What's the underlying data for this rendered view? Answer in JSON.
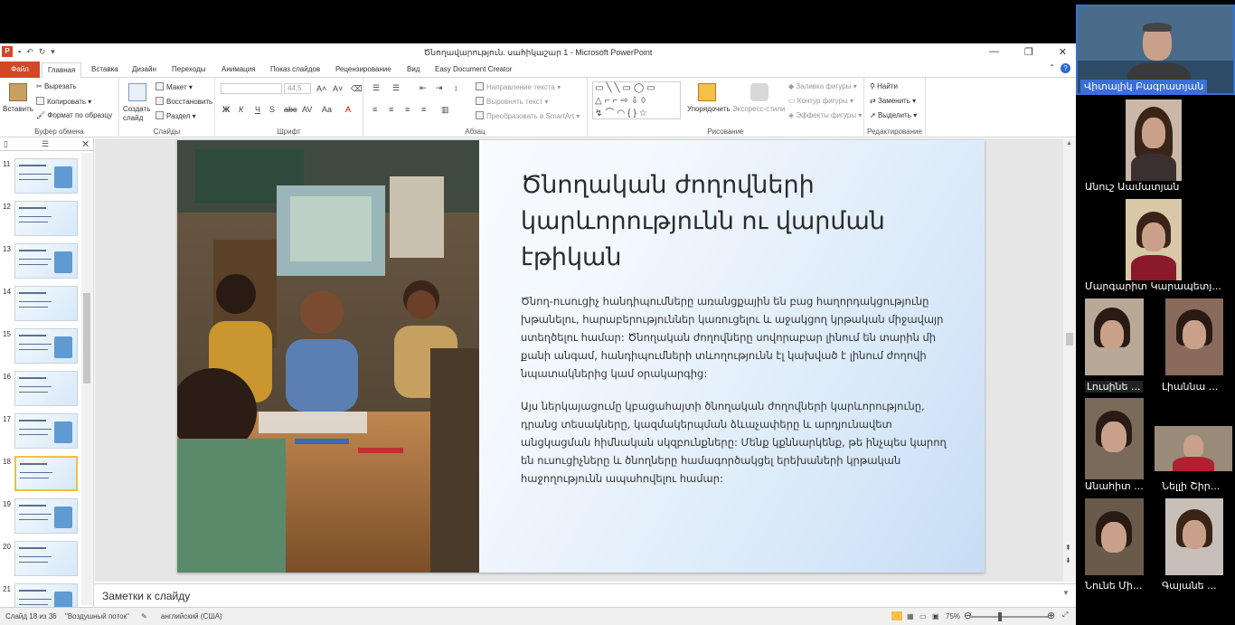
{
  "window": {
    "title": "Ծնողավարություն. սահիկաշար 1  -  Microsoft PowerPoint",
    "app_icon": "P"
  },
  "tabs": {
    "file": "Файл",
    "items": [
      "Главная",
      "Вставка",
      "Дизайн",
      "Переходы",
      "Анимация",
      "Показ слайдов",
      "Рецензирование",
      "Вид",
      "Easy Document Creator"
    ],
    "active": "Главная"
  },
  "ribbon": {
    "clipboard": {
      "paste": "Вставить",
      "cut": "Вырезать",
      "copy": "Копировать",
      "format_painter": "Формат по образцу",
      "label": "Буфер обмена"
    },
    "slides": {
      "new_slide": "Создать слайд",
      "layout": "Макет",
      "reset": "Восстановить",
      "section": "Раздел",
      "label": "Слайды"
    },
    "font": {
      "size": "44,5",
      "label": "Шрифт"
    },
    "paragraph": {
      "text_direction": "Направление текста",
      "align_text": "Выровнять текст",
      "smartart": "Преобразовать в SmartArt",
      "label": "Абзац"
    },
    "drawing": {
      "arrange": "Упорядочить",
      "quick_styles": "Экспресс-стили",
      "shape_fill": "Заливка фигуры",
      "shape_outline": "Контур фигуры",
      "shape_effects": "Эффекты фигуры",
      "label": "Рисование"
    },
    "editing": {
      "find": "Найти",
      "replace": "Заменить",
      "select": "Выделить",
      "label": "Редактирование"
    }
  },
  "thumbnails": [
    {
      "num": "11"
    },
    {
      "num": "12"
    },
    {
      "num": "13"
    },
    {
      "num": "14"
    },
    {
      "num": "15"
    },
    {
      "num": "16"
    },
    {
      "num": "17"
    },
    {
      "num": "18"
    },
    {
      "num": "19"
    },
    {
      "num": "20"
    },
    {
      "num": "21"
    }
  ],
  "selected_slide": "18",
  "slide": {
    "title": "Ծնողական ժողովների կարևորությունն ու վարման էթիկան",
    "p1": "Ծնող-ուսուցիչ հանդիպումները առանցքային են բաց հաղորդակցությունը խթանելու, հարաբերություններ կառուցելու և աջակցող կրթական միջավայր ստեղծելու համար: Ծնողական ժողովները սովորաբար լինում են տարին մի քանի անգամ, հանդիպումների տևողությունն էլ կախված է լինում ժողովի նպատակներից կամ օրակարգից:",
    "p2": "Այս ներկայացումը կբացահայտի ծնողական ժողովների կարևորությունը, դրանց տեսակները, կազմակերպման ձևաչափերը և արդյունավետ անցկացման հիմնական սկզբունքները: Մենք կքննարկենք, թե ինչպես կարող են ուսուցիչները և ծնողները համագործակցել երեխաների կրթական հաջողությունն ապահովելու համար:"
  },
  "notes_placeholder": "Заметки к слайду",
  "status": {
    "slide_of": "Слайд 18 из 36",
    "theme": "\"Воздушный поток\"",
    "language": "английский (США)",
    "zoom": "75%"
  },
  "zoom_level": 0.75,
  "participants": [
    {
      "name": "Վիտալիկ Բագրատյան",
      "active": true
    },
    {
      "name": "Անուշ Աամատյան"
    },
    {
      "name": "Մարգարիտ Կարապետյ..."
    },
    {
      "name": "Լուսինե ..."
    },
    {
      "name": "Լիաննա ..."
    },
    {
      "name": "Անահիտ ..."
    },
    {
      "name": "Նելլի Շիր..."
    },
    {
      "name": "Նունե Մի..."
    },
    {
      "name": "Գայանե ..."
    }
  ],
  "colors": {
    "accent": "#d24726",
    "active_speaker": "#3b6fd6"
  }
}
